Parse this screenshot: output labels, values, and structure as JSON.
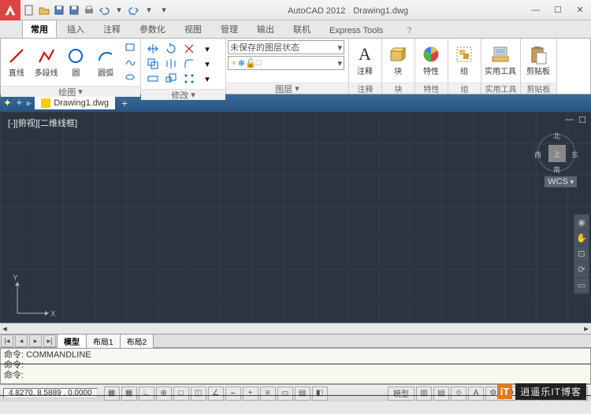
{
  "title": {
    "app": "AutoCAD 2012",
    "doc": "Drawing1.dwg"
  },
  "ribbon_tabs": [
    "常用",
    "插入",
    "注释",
    "参数化",
    "视图",
    "管理",
    "输出",
    "联机",
    "Express Tools"
  ],
  "active_tab": 0,
  "help_tab": "?",
  "draw_panel": {
    "title": "绘图",
    "line": "直线",
    "polyline": "多段线",
    "circle": "圆",
    "arc": "圆弧"
  },
  "modify_panel": {
    "title": "修改"
  },
  "layer_panel": {
    "title": "图层",
    "combo": "未保存的图层状态"
  },
  "annot_panel": {
    "title": "注释",
    "label": "注释"
  },
  "block_panel": {
    "title": "块",
    "label": "块"
  },
  "prop_panel": {
    "title": "特性",
    "label": "特性"
  },
  "group_panel": {
    "title": "组",
    "label": "组"
  },
  "util_panel": {
    "title": "实用工具",
    "label": "实用工具"
  },
  "clip_panel": {
    "title": "剪贴板",
    "label": "剪贴板"
  },
  "doctab": {
    "name": "Drawing1.dwg"
  },
  "viewport": {
    "label": "[-][俯视][二维线框]",
    "cube_face": "上",
    "n": "北",
    "s": "南",
    "e": "东",
    "w": "西",
    "wcs": "WCS"
  },
  "ucs": {
    "x": "X",
    "y": "Y"
  },
  "layout_tabs": [
    "模型",
    "布局1",
    "布局2"
  ],
  "active_layout": 0,
  "cmd": {
    "l1": "命令: COMMANDLINE",
    "l2": "命令:",
    "l3": "命令:"
  },
  "status": {
    "coords": "4.8270, 8.5889 , 0.0000",
    "model": "模型"
  },
  "watermark": {
    "badge": "iT",
    "text": "逍遥乐IT博客"
  }
}
